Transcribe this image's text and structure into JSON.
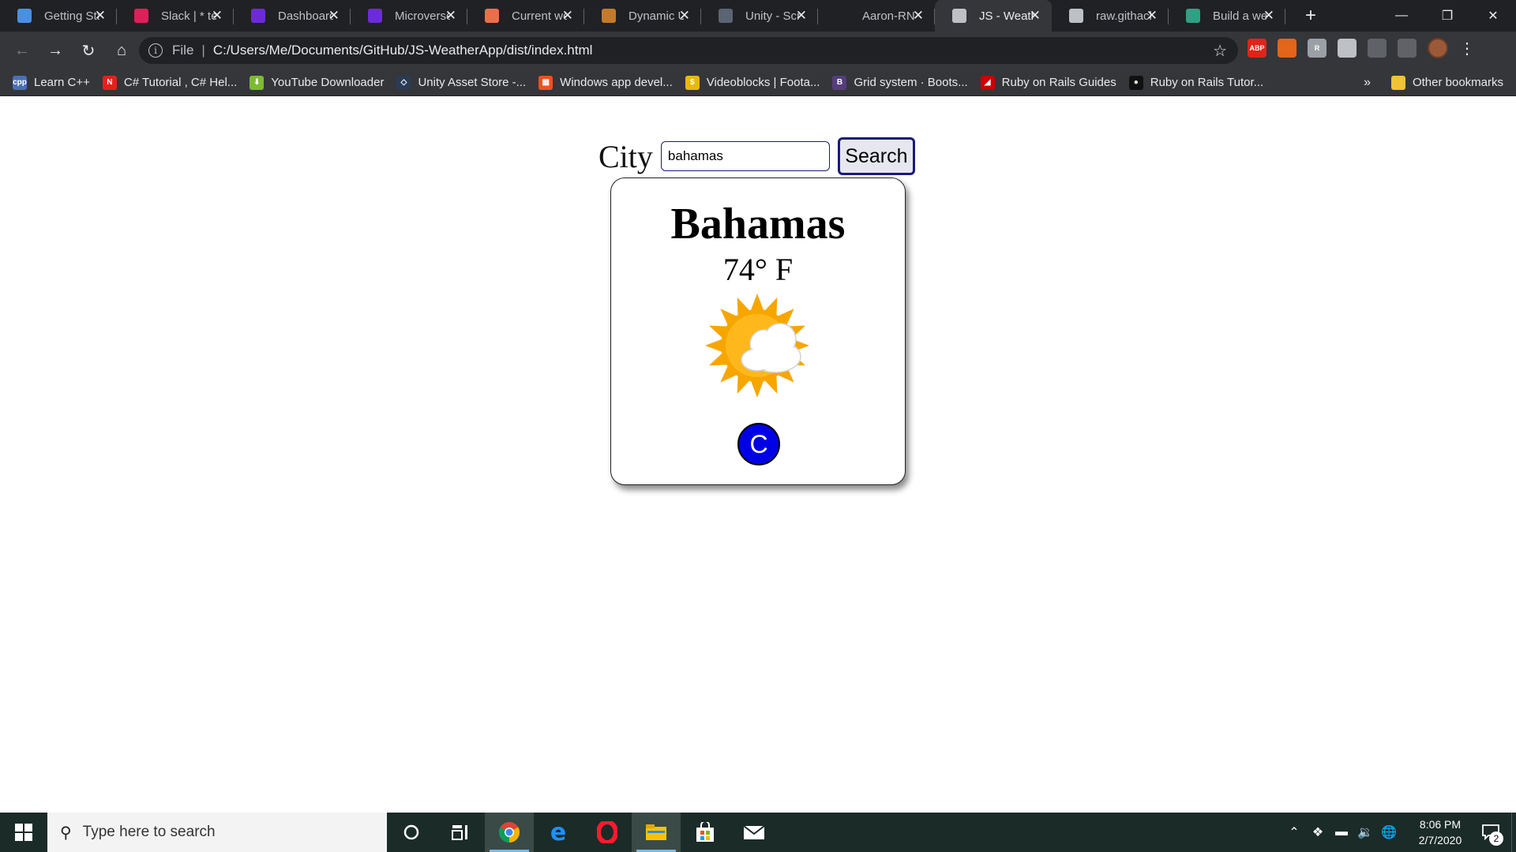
{
  "browser": {
    "tabs": [
      {
        "title": "Getting Started",
        "icon": "gear-hex-icon",
        "color": "#4a90e2"
      },
      {
        "title": "Slack | * test",
        "icon": "slack-icon",
        "color": "#e01e5a"
      },
      {
        "title": "Dashboard",
        "icon": "microverse-icon",
        "color": "#6c2bd9"
      },
      {
        "title": "Microverse",
        "icon": "microverse-icon",
        "color": "#6c2bd9"
      },
      {
        "title": "Current weather",
        "icon": "weather-cloud-icon",
        "color": "#eb6e4b"
      },
      {
        "title": "Dynamic UI",
        "icon": "fox-icon",
        "color": "#c47a2b"
      },
      {
        "title": "Unity - Scripting",
        "icon": "unity-icon",
        "color": "#5b6473"
      },
      {
        "title": "Aaron-RN",
        "icon": "blank-icon",
        "color": "#202124"
      },
      {
        "title": "JS - Weather",
        "icon": "globe-icon",
        "color": "#bdc1c6"
      },
      {
        "title": "raw.githack",
        "icon": "globe-icon",
        "color": "#bdc1c6"
      },
      {
        "title": "Build a weather",
        "icon": "cube-icon",
        "color": "#2ea083"
      }
    ],
    "active_tab_index": 8,
    "address": {
      "scheme_label": "File",
      "url": "C:/Users/Me/Documents/GitHub/JS-WeatherApp/dist/index.html"
    },
    "extensions": [
      {
        "name": "adblock-plus-icon",
        "label": "ABP",
        "color": "#e2231a"
      },
      {
        "name": "office-icon",
        "label": "",
        "color": "#e3641b"
      },
      {
        "name": "notes-icon",
        "label": "R",
        "color": "#9aa0a6"
      },
      {
        "name": "shield-icon",
        "label": "",
        "color": "#bdc1c6"
      },
      {
        "name": "refresh-ext-icon",
        "label": "",
        "color": "#5f6368"
      },
      {
        "name": "mouse-icon",
        "label": "",
        "color": "#5f6368"
      }
    ],
    "bookmarks": [
      {
        "label": "Learn C++",
        "icon": "cpp-icon",
        "color": "#4a6fb5",
        "glyph": "cpp"
      },
      {
        "label": "C# Tutorial , C# Hel...",
        "icon": "n-icon",
        "color": "#e2231a",
        "glyph": "N"
      },
      {
        "label": "YouTube Downloader",
        "icon": "download-arrow-icon",
        "color": "#7cbb31",
        "glyph": "⬇"
      },
      {
        "label": "Unity Asset Store -...",
        "icon": "unity-icon",
        "color": "#2b3b55",
        "glyph": "◇"
      },
      {
        "label": "Windows app devel...",
        "icon": "windows-logo-icon",
        "color": "#f25022",
        "glyph": "▦"
      },
      {
        "label": "Videoblocks | Foota...",
        "icon": "dollar-icon",
        "color": "#e8b90c",
        "glyph": "$"
      },
      {
        "label": "Grid system · Boots...",
        "icon": "bootstrap-icon",
        "color": "#563d7c",
        "glyph": "B"
      },
      {
        "label": "Ruby on Rails Guides",
        "icon": "rails-icon",
        "color": "#cc0000",
        "glyph": "◢"
      },
      {
        "label": "Ruby on Rails Tutor...",
        "icon": "rails-tutorial-icon",
        "color": "#111111",
        "glyph": "●"
      }
    ],
    "bookmarks_more": "»",
    "other_bookmarks": "Other bookmarks"
  },
  "app": {
    "city_label": "City",
    "city_input_value": "bahamas",
    "search_button": "Search",
    "card": {
      "city": "Bahamas",
      "temperature": "74° F",
      "weather_icon": "partly-cloudy-sun-icon",
      "unit_toggle": "C"
    },
    "colors": {
      "accent_border": "#1a1a7a",
      "toggle_bg": "#0000e6",
      "sun": "#f7a600"
    }
  },
  "taskbar": {
    "search_placeholder": "Type here to search",
    "pinned": [
      "cortana-icon",
      "task-view-icon",
      "chrome-icon",
      "edge-icon",
      "opera-icon",
      "file-explorer-icon",
      "store-icon",
      "mail-icon"
    ],
    "clock_time": "8:06 PM",
    "clock_date": "2/7/2020",
    "notification_count": "2"
  }
}
